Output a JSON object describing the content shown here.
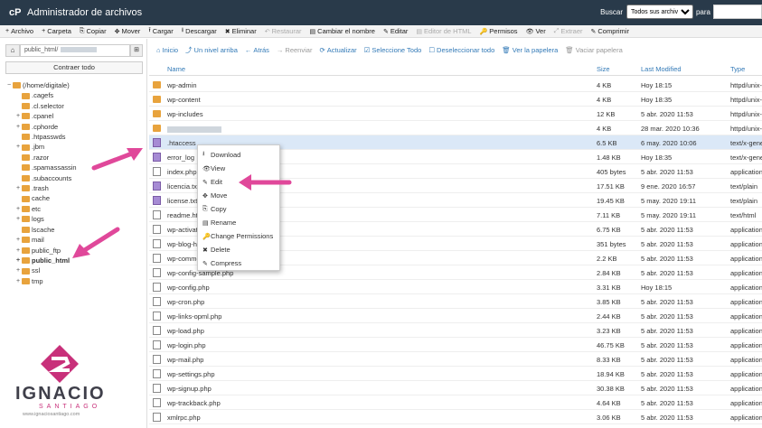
{
  "header": {
    "title": "Administrador de archivos",
    "search_label": "Buscar",
    "search_scope": "Todos sus archivos",
    "for_label": "para"
  },
  "toolbar": [
    {
      "label": "Archivo",
      "icon": "+",
      "disabled": false
    },
    {
      "label": "Carpeta",
      "icon": "+",
      "disabled": false
    },
    {
      "label": "Copiar",
      "icon": "⎘",
      "disabled": false
    },
    {
      "label": "Mover",
      "icon": "✥",
      "disabled": false
    },
    {
      "label": "Cargar",
      "icon": "⭱",
      "disabled": false
    },
    {
      "label": "Descargar",
      "icon": "⭳",
      "disabled": false
    },
    {
      "label": "Eliminar",
      "icon": "✖",
      "disabled": false
    },
    {
      "label": "Restaurar",
      "icon": "↶",
      "disabled": true
    },
    {
      "label": "Cambiar el nombre",
      "icon": "▤",
      "disabled": false
    },
    {
      "label": "Editar",
      "icon": "✎",
      "disabled": false
    },
    {
      "label": "Editor de HTML",
      "icon": "▤",
      "disabled": true
    },
    {
      "label": "Permisos",
      "icon": "🔑",
      "disabled": false
    },
    {
      "label": "Ver",
      "icon": "👁",
      "disabled": false
    },
    {
      "label": "Extraer",
      "icon": "⤢",
      "disabled": true
    },
    {
      "label": "Comprimir",
      "icon": "✎",
      "disabled": false
    }
  ],
  "left": {
    "path_value": "public_html/",
    "collapse_label": "Contraer todo"
  },
  "tree": [
    {
      "label": "(/home/digitale)",
      "pm": "−",
      "indent": 0,
      "bold": false
    },
    {
      "label": ".cagefs",
      "pm": "",
      "indent": 1,
      "bold": false
    },
    {
      "label": ".cl.selector",
      "pm": "",
      "indent": 1,
      "bold": false
    },
    {
      "label": ".cpanel",
      "pm": "+",
      "indent": 1,
      "bold": false
    },
    {
      "label": ".cphorde",
      "pm": "+",
      "indent": 1,
      "bold": false
    },
    {
      "label": ".htpasswds",
      "pm": "",
      "indent": 1,
      "bold": false
    },
    {
      "label": ".jbm",
      "pm": "+",
      "indent": 1,
      "bold": false
    },
    {
      "label": ".razor",
      "pm": "",
      "indent": 1,
      "bold": false
    },
    {
      "label": ".spamassassin",
      "pm": "",
      "indent": 1,
      "bold": false
    },
    {
      "label": ".subaccounts",
      "pm": "",
      "indent": 1,
      "bold": false
    },
    {
      "label": ".trash",
      "pm": "+",
      "indent": 1,
      "bold": false
    },
    {
      "label": "cache",
      "pm": "",
      "indent": 1,
      "bold": false
    },
    {
      "label": "etc",
      "pm": "+",
      "indent": 1,
      "bold": false
    },
    {
      "label": "logs",
      "pm": "+",
      "indent": 1,
      "bold": false
    },
    {
      "label": "lscache",
      "pm": "",
      "indent": 1,
      "bold": false
    },
    {
      "label": "mail",
      "pm": "+",
      "indent": 1,
      "bold": false
    },
    {
      "label": "public_ftp",
      "pm": "+",
      "indent": 1,
      "bold": false
    },
    {
      "label": "public_html",
      "pm": "+",
      "indent": 1,
      "bold": true
    },
    {
      "label": "ssl",
      "pm": "+",
      "indent": 1,
      "bold": false
    },
    {
      "label": "tmp",
      "pm": "+",
      "indent": 1,
      "bold": false
    }
  ],
  "navbar": [
    {
      "label": "Inicio",
      "icon": "⌂",
      "disabled": false
    },
    {
      "label": "Un nivel arriba",
      "icon": "⤴",
      "disabled": false
    },
    {
      "label": "Atrás",
      "icon": "←",
      "disabled": false
    },
    {
      "label": "Reenviar",
      "icon": "→",
      "disabled": true
    },
    {
      "label": "Actualizar",
      "icon": "⟳",
      "disabled": false
    },
    {
      "label": "Seleccione Todo",
      "icon": "☑",
      "disabled": false
    },
    {
      "label": "Deseleccionar todo",
      "icon": "☐",
      "disabled": false
    },
    {
      "label": "Ver la papelera",
      "icon": "🗑",
      "disabled": false
    },
    {
      "label": "Vaciar papelera",
      "icon": "🗑",
      "disabled": true
    }
  ],
  "columns": {
    "name": "Name",
    "size": "Size",
    "modified": "Last Modified",
    "type": "Type"
  },
  "files": [
    {
      "name": "wp-admin",
      "kind": "folder",
      "size": "4 KB",
      "mod": "Hoy 18:15",
      "type": "httpd/unix-d",
      "blur": false,
      "sel": false
    },
    {
      "name": "wp-content",
      "kind": "folder",
      "size": "4 KB",
      "mod": "Hoy 18:35",
      "type": "httpd/unix-d",
      "blur": false,
      "sel": false
    },
    {
      "name": "wp-includes",
      "kind": "folder",
      "size": "12 KB",
      "mod": "5 abr. 2020 11:53",
      "type": "httpd/unix-d",
      "blur": false,
      "sel": false
    },
    {
      "name": "",
      "kind": "folder",
      "size": "4 KB",
      "mod": "28 mar. 2020 10:36",
      "type": "httpd/unix-d",
      "blur": true,
      "sel": false
    },
    {
      "name": ".htaccess",
      "kind": "purple",
      "size": "6.5 KB",
      "mod": "6 may. 2020 10:06",
      "type": "text/x-gene",
      "blur": false,
      "sel": true
    },
    {
      "name": "error_log",
      "kind": "purple",
      "size": "1.48 KB",
      "mod": "Hoy 18:35",
      "type": "text/x-gene",
      "blur": false,
      "sel": false
    },
    {
      "name": "index.php",
      "kind": "file",
      "size": "405 bytes",
      "mod": "5 abr. 2020 11:53",
      "type": "application/",
      "blur": false,
      "sel": false
    },
    {
      "name": "licencia.txt",
      "kind": "purple",
      "size": "17.51 KB",
      "mod": "9 ene. 2020 16:57",
      "type": "text/plain",
      "blur": false,
      "sel": false
    },
    {
      "name": "license.txt",
      "kind": "purple",
      "size": "19.45 KB",
      "mod": "5 may. 2020 19:11",
      "type": "text/plain",
      "blur": false,
      "sel": false
    },
    {
      "name": "readme.html",
      "kind": "file",
      "size": "7.11 KB",
      "mod": "5 may. 2020 19:11",
      "type": "text/html",
      "blur": false,
      "sel": false
    },
    {
      "name": "wp-activate.php",
      "kind": "file",
      "size": "6.75 KB",
      "mod": "5 abr. 2020 11:53",
      "type": "application/",
      "blur": false,
      "sel": false
    },
    {
      "name": "wp-blog-header.php",
      "kind": "file",
      "size": "351 bytes",
      "mod": "5 abr. 2020 11:53",
      "type": "application/",
      "blur": false,
      "sel": false
    },
    {
      "name": "wp-comments-post.php",
      "kind": "file",
      "size": "2.2 KB",
      "mod": "5 abr. 2020 11:53",
      "type": "application/",
      "blur": false,
      "sel": false
    },
    {
      "name": "wp-config-sample.php",
      "kind": "file",
      "size": "2.84 KB",
      "mod": "5 abr. 2020 11:53",
      "type": "application/",
      "blur": false,
      "sel": false
    },
    {
      "name": "wp-config.php",
      "kind": "file",
      "size": "3.31 KB",
      "mod": "Hoy 18:15",
      "type": "application/",
      "blur": false,
      "sel": false
    },
    {
      "name": "wp-cron.php",
      "kind": "file",
      "size": "3.85 KB",
      "mod": "5 abr. 2020 11:53",
      "type": "application/",
      "blur": false,
      "sel": false
    },
    {
      "name": "wp-links-opml.php",
      "kind": "file",
      "size": "2.44 KB",
      "mod": "5 abr. 2020 11:53",
      "type": "application/",
      "blur": false,
      "sel": false
    },
    {
      "name": "wp-load.php",
      "kind": "file",
      "size": "3.23 KB",
      "mod": "5 abr. 2020 11:53",
      "type": "application/",
      "blur": false,
      "sel": false
    },
    {
      "name": "wp-login.php",
      "kind": "file",
      "size": "46.75 KB",
      "mod": "5 abr. 2020 11:53",
      "type": "application/",
      "blur": false,
      "sel": false
    },
    {
      "name": "wp-mail.php",
      "kind": "file",
      "size": "8.33 KB",
      "mod": "5 abr. 2020 11:53",
      "type": "application/",
      "blur": false,
      "sel": false
    },
    {
      "name": "wp-settings.php",
      "kind": "file",
      "size": "18.94 KB",
      "mod": "5 abr. 2020 11:53",
      "type": "application/",
      "blur": false,
      "sel": false
    },
    {
      "name": "wp-signup.php",
      "kind": "file",
      "size": "30.38 KB",
      "mod": "5 abr. 2020 11:53",
      "type": "application/",
      "blur": false,
      "sel": false
    },
    {
      "name": "wp-trackback.php",
      "kind": "file",
      "size": "4.64 KB",
      "mod": "5 abr. 2020 11:53",
      "type": "application/",
      "blur": false,
      "sel": false
    },
    {
      "name": "xmlrpc.php",
      "kind": "file",
      "size": "3.06 KB",
      "mod": "5 abr. 2020 11:53",
      "type": "application/",
      "blur": false,
      "sel": false
    }
  ],
  "context_menu": [
    {
      "label": "Download",
      "icon": "⭳"
    },
    {
      "label": "View",
      "icon": "👁"
    },
    {
      "label": "Edit",
      "icon": "✎"
    },
    {
      "label": "Move",
      "icon": "✥"
    },
    {
      "label": "Copy",
      "icon": "⎘"
    },
    {
      "label": "Rename",
      "icon": "▤"
    },
    {
      "label": "Change Permissions",
      "icon": "🔑"
    },
    {
      "label": "Delete",
      "icon": "✖"
    },
    {
      "label": "Compress",
      "icon": "✎"
    }
  ],
  "watermark": {
    "name": "IGNACIO",
    "sub": "SANTIAGO",
    "url": "www.ignaciosantiago.com"
  },
  "colors": {
    "header_bg": "#293a4a",
    "link": "#337ab7",
    "arrow": "#e0489a",
    "folder": "#e8a33d",
    "selected_row": "#dbe8f7"
  }
}
